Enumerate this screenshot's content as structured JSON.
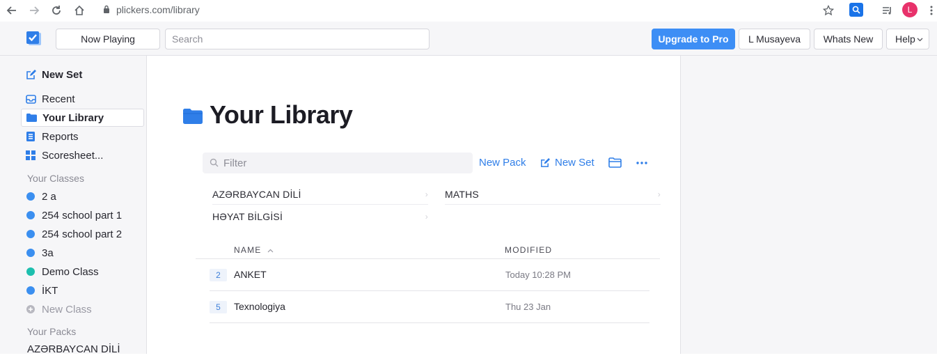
{
  "browser": {
    "url": "plickers.com/library",
    "avatar_letter": "L"
  },
  "topbar": {
    "now_playing": "Now Playing",
    "search_placeholder": "Search",
    "upgrade": "Upgrade to Pro",
    "user": "L Musayeva",
    "whats_new": "Whats New",
    "help": "Help"
  },
  "sidebar": {
    "new_set": "New Set",
    "recent": "Recent",
    "library": "Your Library",
    "reports": "Reports",
    "scoresheet": "Scoresheet...",
    "classes_header": "Your Classes",
    "classes": [
      {
        "label": "2 a",
        "color": "#3b8ff0"
      },
      {
        "label": "254 school part 1",
        "color": "#3b8ff0"
      },
      {
        "label": "254 school part 2",
        "color": "#3b8ff0"
      },
      {
        "label": "3a",
        "color": "#3b8ff0"
      },
      {
        "label": "Demo Class",
        "color": "#1dbfae"
      },
      {
        "label": "İKT",
        "color": "#3b8ff0"
      }
    ],
    "new_class": "New Class",
    "packs_header": "Your Packs",
    "packs": [
      "AZƏRBAYCAN DİLİ"
    ]
  },
  "main": {
    "title": "Your Library",
    "filter_placeholder": "Filter",
    "new_pack": "New Pack",
    "new_set": "New Set",
    "folders": [
      "AZƏRBAYCAN DİLİ",
      "MATHS",
      "HƏYAT BİLGİSİ"
    ],
    "col_name": "NAME",
    "col_modified": "MODIFIED",
    "rows": [
      {
        "count": "2",
        "name": "ANKET",
        "modified": "Today 10:28 PM"
      },
      {
        "count": "5",
        "name": "Texnologiya",
        "modified": "Thu 23 Jan"
      }
    ]
  },
  "colors": {
    "accent": "#3d8ef5",
    "link": "#2f7ee8"
  }
}
